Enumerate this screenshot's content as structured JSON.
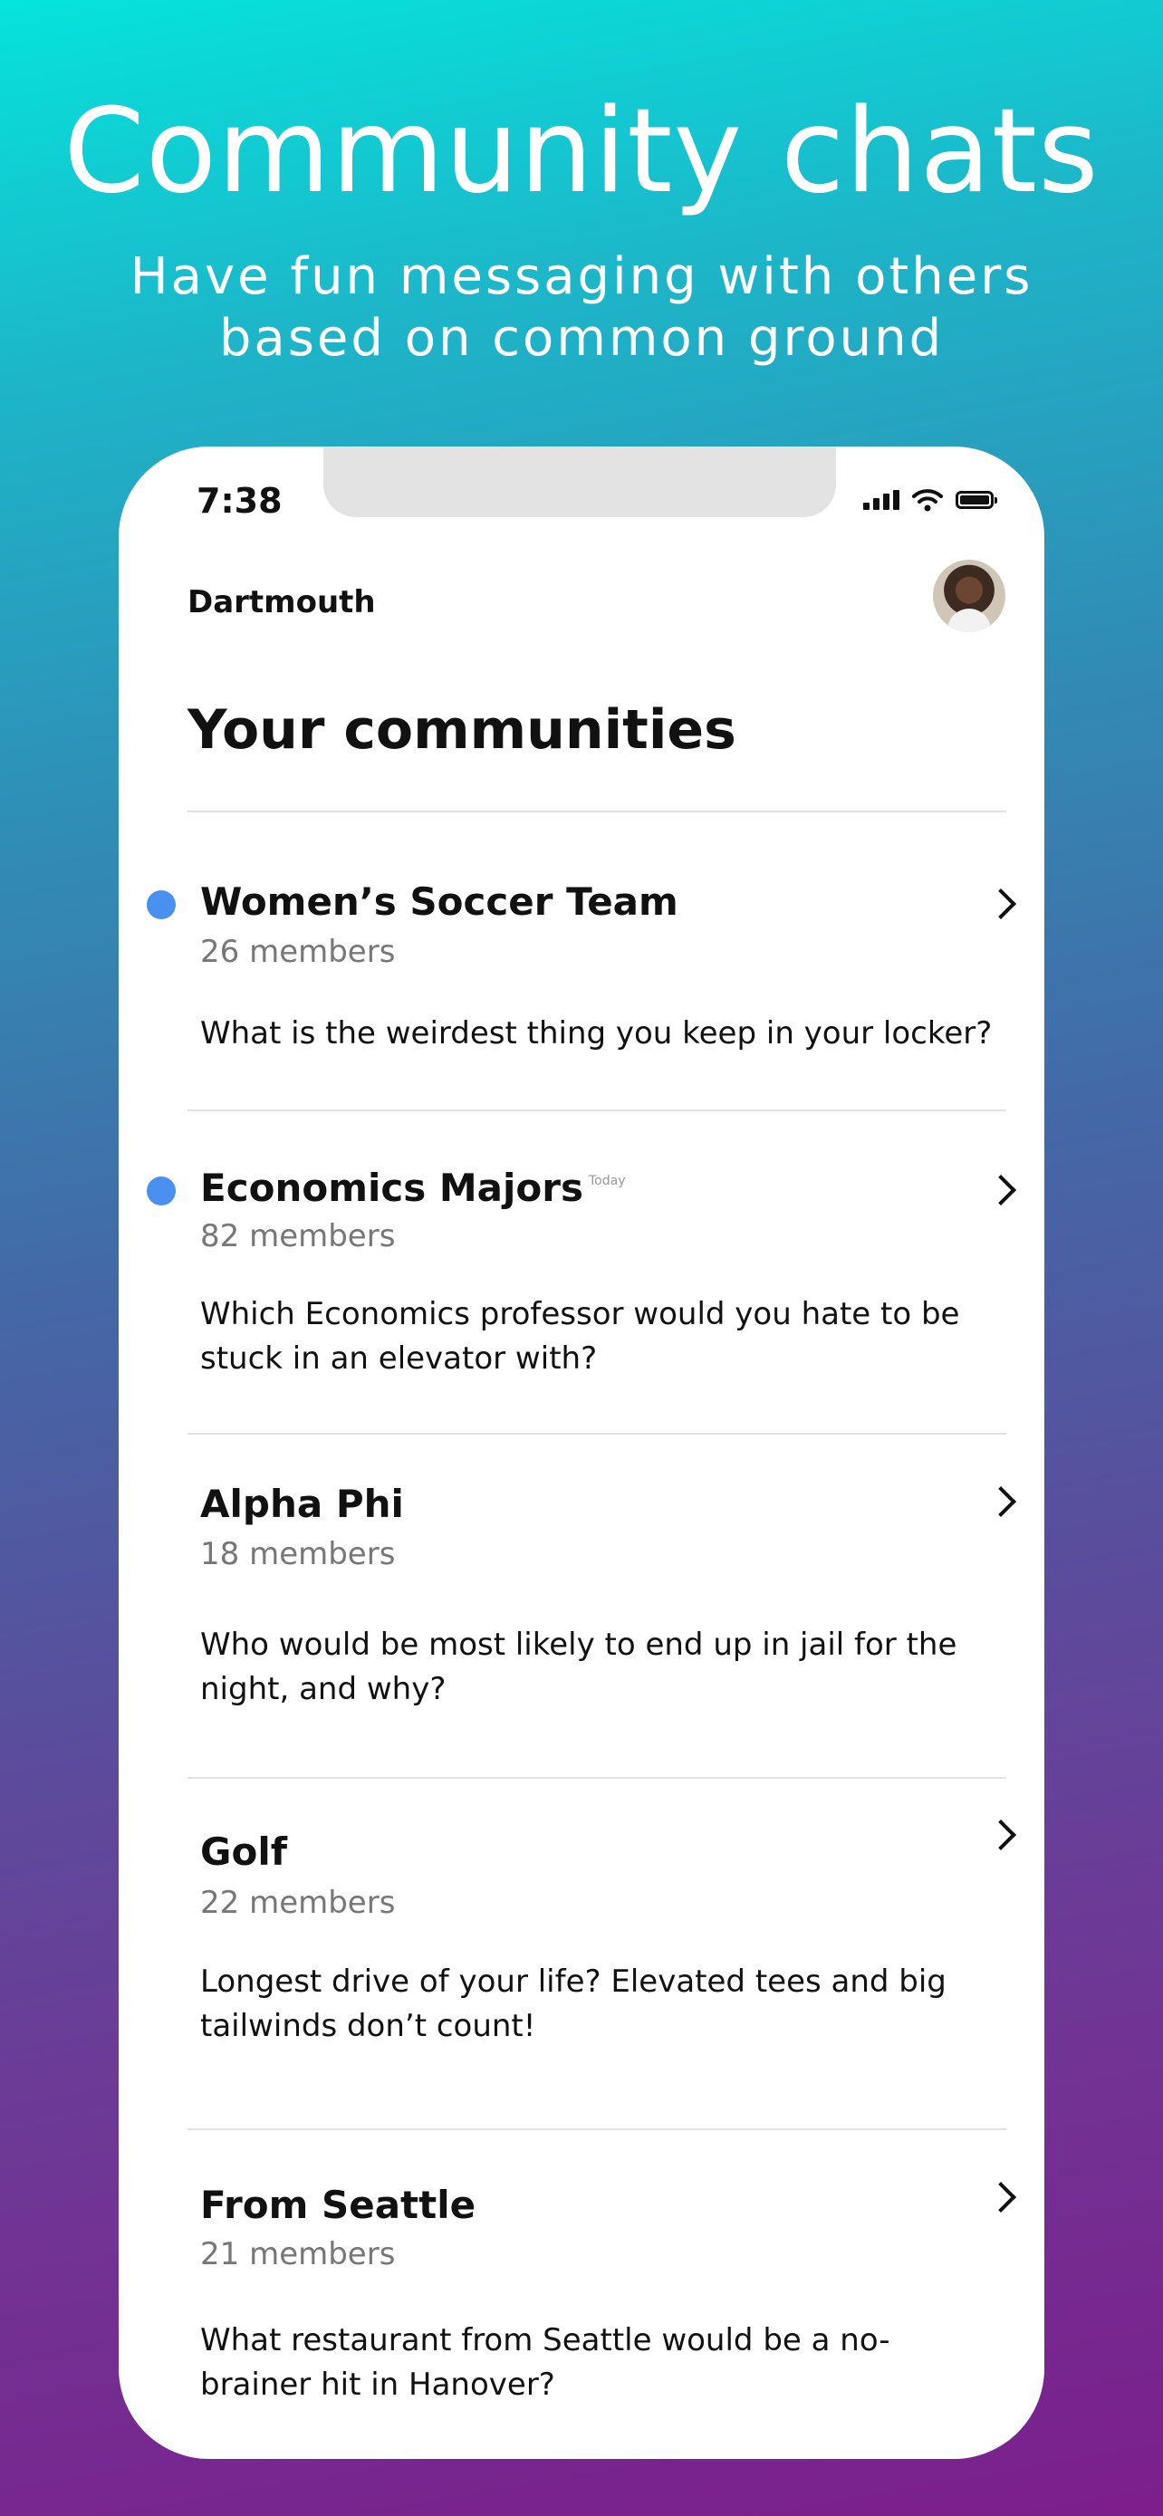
{
  "hero": {
    "title": "Community chats",
    "subtitle_line1": "Have fun messaging with others",
    "subtitle_line2": "based on common ground"
  },
  "status_bar": {
    "time": "7:38",
    "icons": [
      "signal-icon",
      "wifi-icon",
      "battery-icon"
    ]
  },
  "header": {
    "org": "Dartmouth",
    "avatar": "user-avatar"
  },
  "page": {
    "title": "Your communities"
  },
  "colors": {
    "unread_dot": "#4a90f0",
    "gradient_top": "#06e3dc",
    "gradient_bottom": "#7c1e8c"
  },
  "communities": [
    {
      "name": "Women’s Soccer Team",
      "tag": "",
      "members": "26 members",
      "prompt": "What is the weirdest thing you keep in your locker?",
      "unread": true
    },
    {
      "name": "Economics Majors",
      "tag": "Today",
      "members": "82 members",
      "prompt": "Which Economics professor would you hate to be stuck in an elevator with?",
      "unread": true
    },
    {
      "name": "Alpha Phi",
      "tag": "",
      "members": "18 members",
      "prompt": "Who would be most likely to end up in jail for the night, and why?",
      "unread": false
    },
    {
      "name": "Golf",
      "tag": "",
      "members": "22 members",
      "prompt": "Longest drive of your life? Elevated tees and big tailwinds don’t count!",
      "unread": false
    },
    {
      "name": "From Seattle",
      "tag": "",
      "members": "21 members",
      "prompt": "What restaurant from Seattle would be a no-brainer hit in Hanover?",
      "unread": false
    }
  ]
}
